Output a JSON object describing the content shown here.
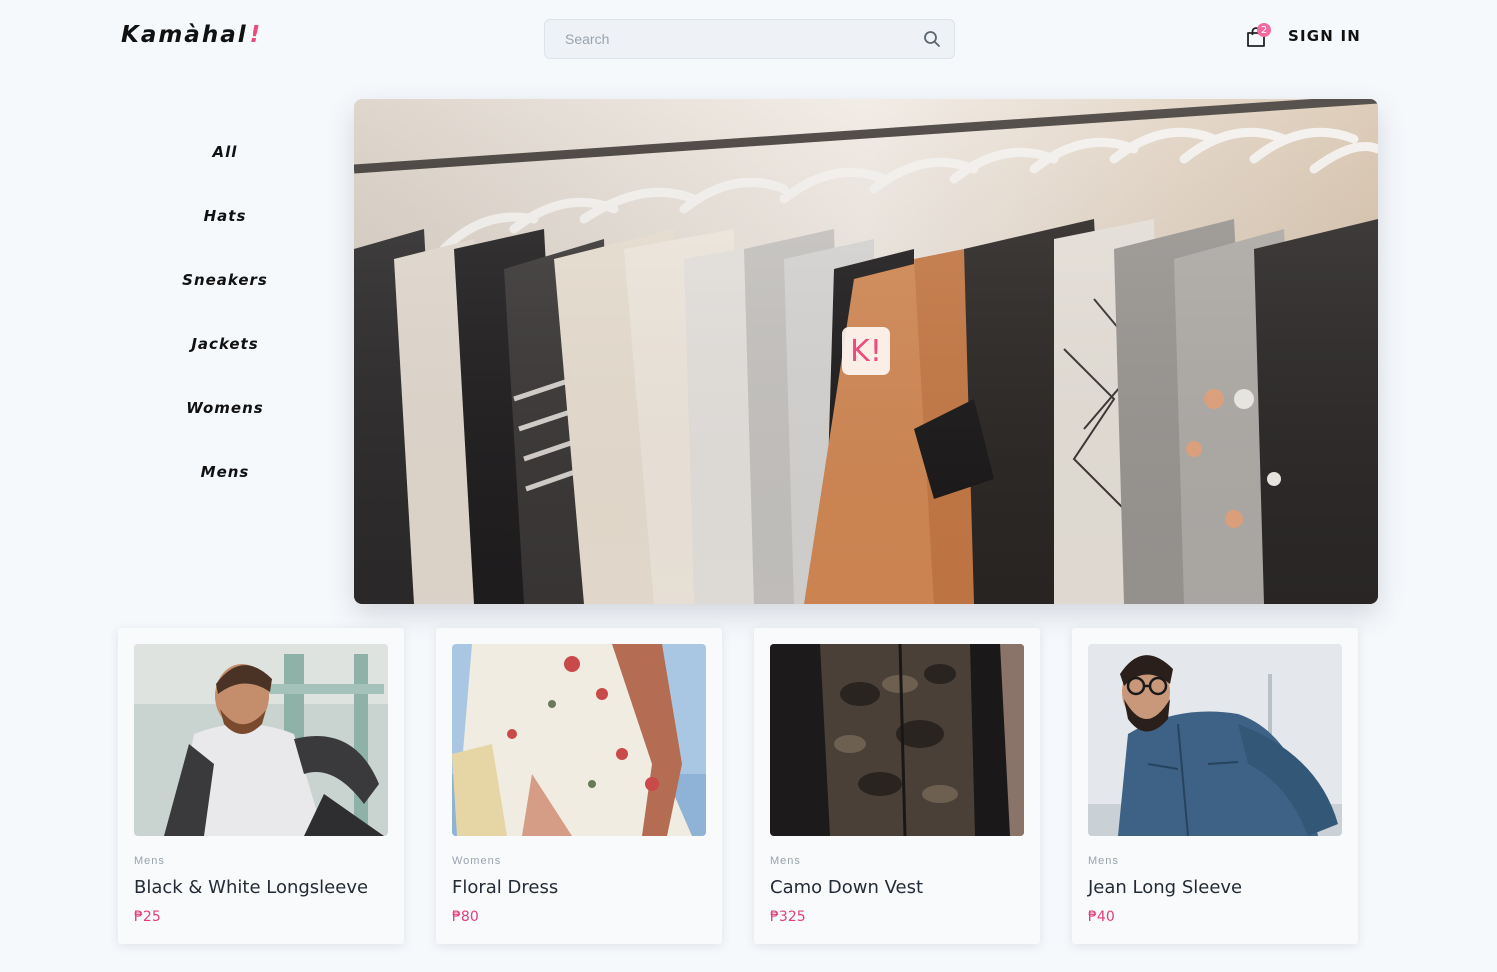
{
  "header": {
    "logo_text": "Kamàhal",
    "logo_mark": "!",
    "search_placeholder": "Search",
    "search_icon": "search-icon",
    "cart_icon": "shopping-bag-icon",
    "cart_count": "2",
    "sign_in_label": "SIGN IN"
  },
  "sidebar": {
    "items": [
      {
        "label": "All"
      },
      {
        "label": "Hats"
      },
      {
        "label": "Sneakers"
      },
      {
        "label": "Jackets"
      },
      {
        "label": "Womens"
      },
      {
        "label": "Mens"
      }
    ]
  },
  "hero": {
    "image": "clothing-rack-photo",
    "badge_text": "K!"
  },
  "products": [
    {
      "category": "Mens",
      "name": "Black & White Longsleeve",
      "price": "₱25",
      "image": "man-in-raglan-shirt-photo"
    },
    {
      "category": "Womens",
      "name": "Floral Dress",
      "price": "₱80",
      "image": "floral-dress-photo"
    },
    {
      "category": "Mens",
      "name": "Camo Down Vest",
      "price": "₱325",
      "image": "camo-vest-photo"
    },
    {
      "category": "Mens",
      "name": "Jean Long Sleeve",
      "price": "₱40",
      "image": "denim-shirt-man-photo"
    }
  ],
  "colors": {
    "accent": "#ec4b7e",
    "price": "#e0407a",
    "background": "#f6f9fc"
  }
}
